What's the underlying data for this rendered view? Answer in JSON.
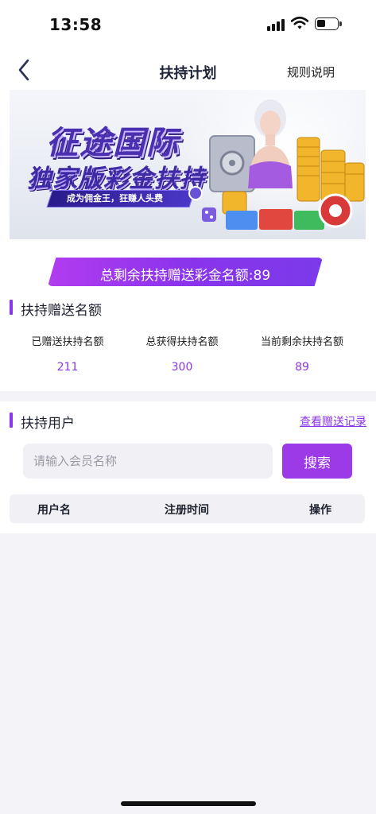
{
  "status_bar": {
    "time": "13:58"
  },
  "header": {
    "title": "扶持计划",
    "rules_label": "规则说明"
  },
  "banner": {
    "title_line1": "征途国际",
    "title_line2": "独家版彩金扶持",
    "ribbon_text": "成为佣金王，狂赚人头费"
  },
  "total_badge": "总剩余扶持赠送彩金名额:89",
  "quota_section": {
    "title": "扶持赠送名额",
    "stats": [
      {
        "label": "已赠送扶持名额",
        "value": "211"
      },
      {
        "label": "总获得扶持名额",
        "value": "300"
      },
      {
        "label": "当前剩余扶持名额",
        "value": "89"
      }
    ]
  },
  "users_section": {
    "title": "扶持用户",
    "records_link": "查看赠送记录",
    "search_placeholder": "请输入会员名称",
    "search_button": "搜索",
    "columns": [
      "用户名",
      "注册时间",
      "操作"
    ]
  },
  "colors": {
    "accent": "#8a36e8",
    "button": "#9b3ae6",
    "badge_start": "#b23cf0",
    "badge_end": "#7b3aea"
  },
  "icons": [
    "back-arrow-icon",
    "signal-icon",
    "wifi-icon",
    "battery-icon"
  ]
}
